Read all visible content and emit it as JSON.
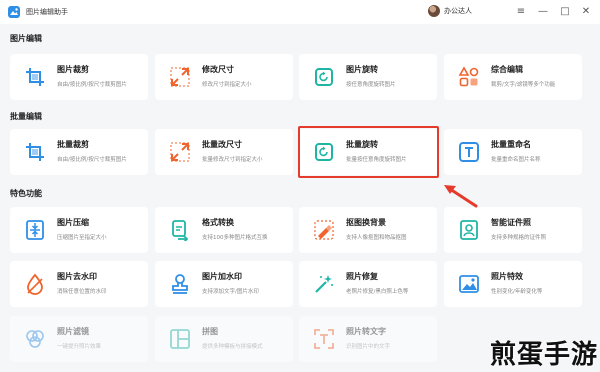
{
  "app": {
    "title": "图片编辑助手",
    "user": "办公达人"
  },
  "window_controls": [
    "≡",
    "—",
    "□",
    "✕"
  ],
  "sections": [
    {
      "title": "图片编辑",
      "items": [
        {
          "title": "图片裁剪",
          "desc": "自由/按比例/按尺寸裁剪图片",
          "icon": "crop-icon"
        },
        {
          "title": "修改尺寸",
          "desc": "修改尺寸到指定大小",
          "icon": "resize-icon"
        },
        {
          "title": "图片旋转",
          "desc": "按任意角度旋转图片",
          "icon": "rotate-icon"
        },
        {
          "title": "综合编辑",
          "desc": "裁剪/文字/滤镜等多个功能",
          "icon": "shapes-icon"
        }
      ]
    },
    {
      "title": "批量编辑",
      "items": [
        {
          "title": "批量裁剪",
          "desc": "自由/按比例/按尺寸裁剪图片",
          "icon": "crop-icon"
        },
        {
          "title": "批量改尺寸",
          "desc": "批量修改尺寸到指定大小",
          "icon": "resize-icon"
        },
        {
          "title": "批量旋转",
          "desc": "批量按任意角度旋转图片",
          "icon": "rotate-icon"
        },
        {
          "title": "批量重命名",
          "desc": "批量重命名图片名称",
          "icon": "text-icon"
        }
      ]
    },
    {
      "title": "特色功能",
      "items": [
        {
          "title": "图片压缩",
          "desc": "压缩图片至指定大小",
          "icon": "compress-icon"
        },
        {
          "title": "格式转换",
          "desc": "支持100多种图片格式互换",
          "icon": "convert-icon"
        },
        {
          "title": "抠图换背景",
          "desc": "支持人像抠图和物品抠图",
          "icon": "cutout-icon"
        },
        {
          "title": "智能证件照",
          "desc": "支持多种规格的证件照",
          "icon": "id-photo-icon"
        },
        {
          "title": "图片去水印",
          "desc": "消除任意位置的水印",
          "icon": "drop-icon"
        },
        {
          "title": "图片加水印",
          "desc": "支持添加文字/图片水印",
          "icon": "stamp-icon"
        },
        {
          "title": "照片修复",
          "desc": "老照片修复/黑白照上色等",
          "icon": "magic-wand-icon"
        },
        {
          "title": "照片特效",
          "desc": "性别变化/年龄变化等",
          "icon": "picture-icon"
        },
        {
          "title": "照片滤镜",
          "desc": "一键提升照片效果",
          "icon": "filter-icon"
        },
        {
          "title": "拼图",
          "desc": "提供多种模板与拼接模式",
          "icon": "collage-icon"
        },
        {
          "title": "照片转文字",
          "desc": "识别图片中的文字",
          "icon": "ocr-icon"
        }
      ]
    }
  ],
  "watermark": "煎蛋手游",
  "colors": {
    "accent": "#2f8fe6",
    "highlight": "#e53b2c",
    "background": "#f5f6f8"
  }
}
